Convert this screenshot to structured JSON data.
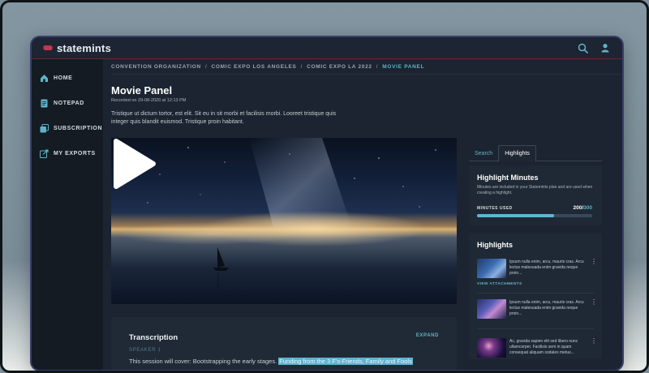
{
  "app": {
    "logo_text": "statemints",
    "brand_color": "#c1394b",
    "accent": "#5fb3c8"
  },
  "header": {
    "icons": [
      "search-icon",
      "user-icon"
    ]
  },
  "sidebar": {
    "items": [
      {
        "label": "HOME",
        "icon": "home-icon"
      },
      {
        "label": "NOTEPAD",
        "icon": "notepad-icon"
      },
      {
        "label": "SUBSCRIPTION",
        "icon": "subscription-icon"
      },
      {
        "label": "MY EXPORTS",
        "icon": "export-icon"
      }
    ]
  },
  "breadcrumb": [
    "CONVENTION ORGANIZATION",
    "COMIC EXPO LOS ANGELES",
    "COMIC EXPO LA 2022",
    "MOVIE PANEL"
  ],
  "breadcrumb_sep": "/",
  "page": {
    "title": "Movie Panel",
    "recorded": "Recorded on 29-08-2020 at 12:13 PM",
    "description": "Tristique ut dictum tortor, est elit. Sit eu in sit morbi et facilisis morbi. Looreet tristique quis integer quis blandit euismod. Tristique proin habitant."
  },
  "video": {
    "play_icon": "play-icon"
  },
  "transcription": {
    "title": "Transcription",
    "expand_label": "EXPAND",
    "speaker": "SPEAKER 1",
    "text_plain": "This session will cover: Bootstrapping the early stages. ",
    "text_highlight": "Funding from the 3 F's-Friends, Family and Fools"
  },
  "tabs": {
    "search": "Search",
    "highlights": "Highlights"
  },
  "highlight_minutes": {
    "title": "Highlight Minutes",
    "subtitle": "Minutes are included in your Statemints plan and are used when creating a highlight.",
    "label": "MINUTES USED",
    "used": "200",
    "separator": "/",
    "total": "300",
    "progress_fraction": 0.667
  },
  "highlights": {
    "title": "Highlights",
    "view_attachments": "VIEW ATTACHMENTS",
    "items": [
      {
        "text": "Ipsum nulla enim, arcu, mauris cras. Arcu lectus malesuada enim gravida neque proin..."
      },
      {
        "text": "Ipsum nulla enim, arcu, mauris cras. Arcu lectus malesuada enim gravida neque proin..."
      },
      {
        "text": "Ac, gravida sapien elit sed libero nunc ullamcorper. Facilisis sem in quam consequat aliquam sodales metus..."
      }
    ],
    "menu_glyph": "⋮"
  }
}
